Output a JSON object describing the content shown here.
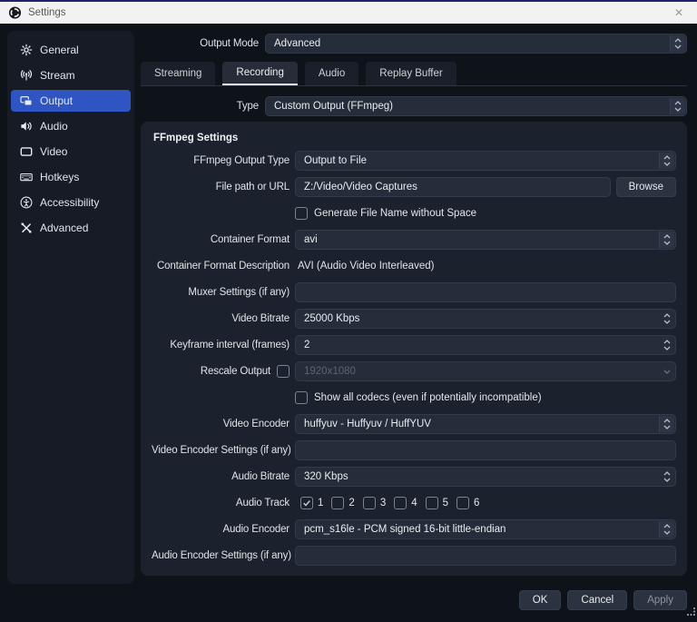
{
  "titlebar": {
    "title": "Settings",
    "close_glyph": "✕"
  },
  "sidebar": {
    "items": [
      {
        "label": "General",
        "icon": "gear-icon",
        "active": false
      },
      {
        "label": "Stream",
        "icon": "broadcast-icon",
        "active": false
      },
      {
        "label": "Output",
        "icon": "output-icon",
        "active": true
      },
      {
        "label": "Audio",
        "icon": "speaker-icon",
        "active": false
      },
      {
        "label": "Video",
        "icon": "monitor-icon",
        "active": false
      },
      {
        "label": "Hotkeys",
        "icon": "keyboard-icon",
        "active": false
      },
      {
        "label": "Accessibility",
        "icon": "accessibility-icon",
        "active": false
      },
      {
        "label": "Advanced",
        "icon": "tools-icon",
        "active": false
      }
    ]
  },
  "top": {
    "output_mode_label": "Output Mode",
    "output_mode_value": "Advanced",
    "type_label": "Type",
    "type_value": "Custom Output (FFmpeg)"
  },
  "tabs": [
    {
      "label": "Streaming",
      "active": false
    },
    {
      "label": "Recording",
      "active": true
    },
    {
      "label": "Audio",
      "active": false
    },
    {
      "label": "Replay Buffer",
      "active": false
    }
  ],
  "ffmpeg": {
    "group_title": "FFmpeg Settings",
    "output_type": {
      "label": "FFmpeg Output Type",
      "value": "Output to File"
    },
    "file_path": {
      "label": "File path or URL",
      "value": "Z:/Video/Video Captures",
      "browse_label": "Browse"
    },
    "gen_no_space": {
      "label": "Generate File Name without Space",
      "checked": false
    },
    "container_format": {
      "label": "Container Format",
      "value": "avi"
    },
    "container_desc": {
      "label": "Container Format Description",
      "value": "AVI (Audio Video Interleaved)"
    },
    "muxer": {
      "label": "Muxer Settings (if any)",
      "value": ""
    },
    "video_bitrate": {
      "label": "Video Bitrate",
      "value": "25000 Kbps"
    },
    "keyframe": {
      "label": "Keyframe interval (frames)",
      "value": "2"
    },
    "rescale": {
      "label": "Rescale Output",
      "checked": false,
      "value": "1920x1080",
      "disabled": true
    },
    "show_codecs": {
      "label": "Show all codecs (even if potentially incompatible)",
      "checked": false
    },
    "video_encoder": {
      "label": "Video Encoder",
      "value": "huffyuv - Huffyuv / HuffYUV"
    },
    "video_enc_settings": {
      "label": "Video Encoder Settings (if any)",
      "value": ""
    },
    "audio_bitrate": {
      "label": "Audio Bitrate",
      "value": "320 Kbps"
    },
    "audio_track": {
      "label": "Audio Track",
      "tracks": [
        {
          "n": "1",
          "checked": true
        },
        {
          "n": "2",
          "checked": false
        },
        {
          "n": "3",
          "checked": false
        },
        {
          "n": "4",
          "checked": false
        },
        {
          "n": "5",
          "checked": false
        },
        {
          "n": "6",
          "checked": false
        }
      ]
    },
    "audio_encoder": {
      "label": "Audio Encoder",
      "value": "pcm_s16le - PCM signed 16-bit little-endian"
    },
    "audio_enc_settings": {
      "label": "Audio Encoder Settings (if any)",
      "value": ""
    }
  },
  "footer": {
    "ok_label": "OK",
    "cancel_label": "Cancel",
    "apply_label": "Apply"
  },
  "colors": {
    "accent": "#2f55c2",
    "window_bg": "#0e1219",
    "sidebar_bg": "#161b26",
    "group_bg": "#1c222d",
    "input_bg": "#262d3a",
    "titlebar_bg": "#f2f2f2",
    "top_line": "#22226b"
  }
}
